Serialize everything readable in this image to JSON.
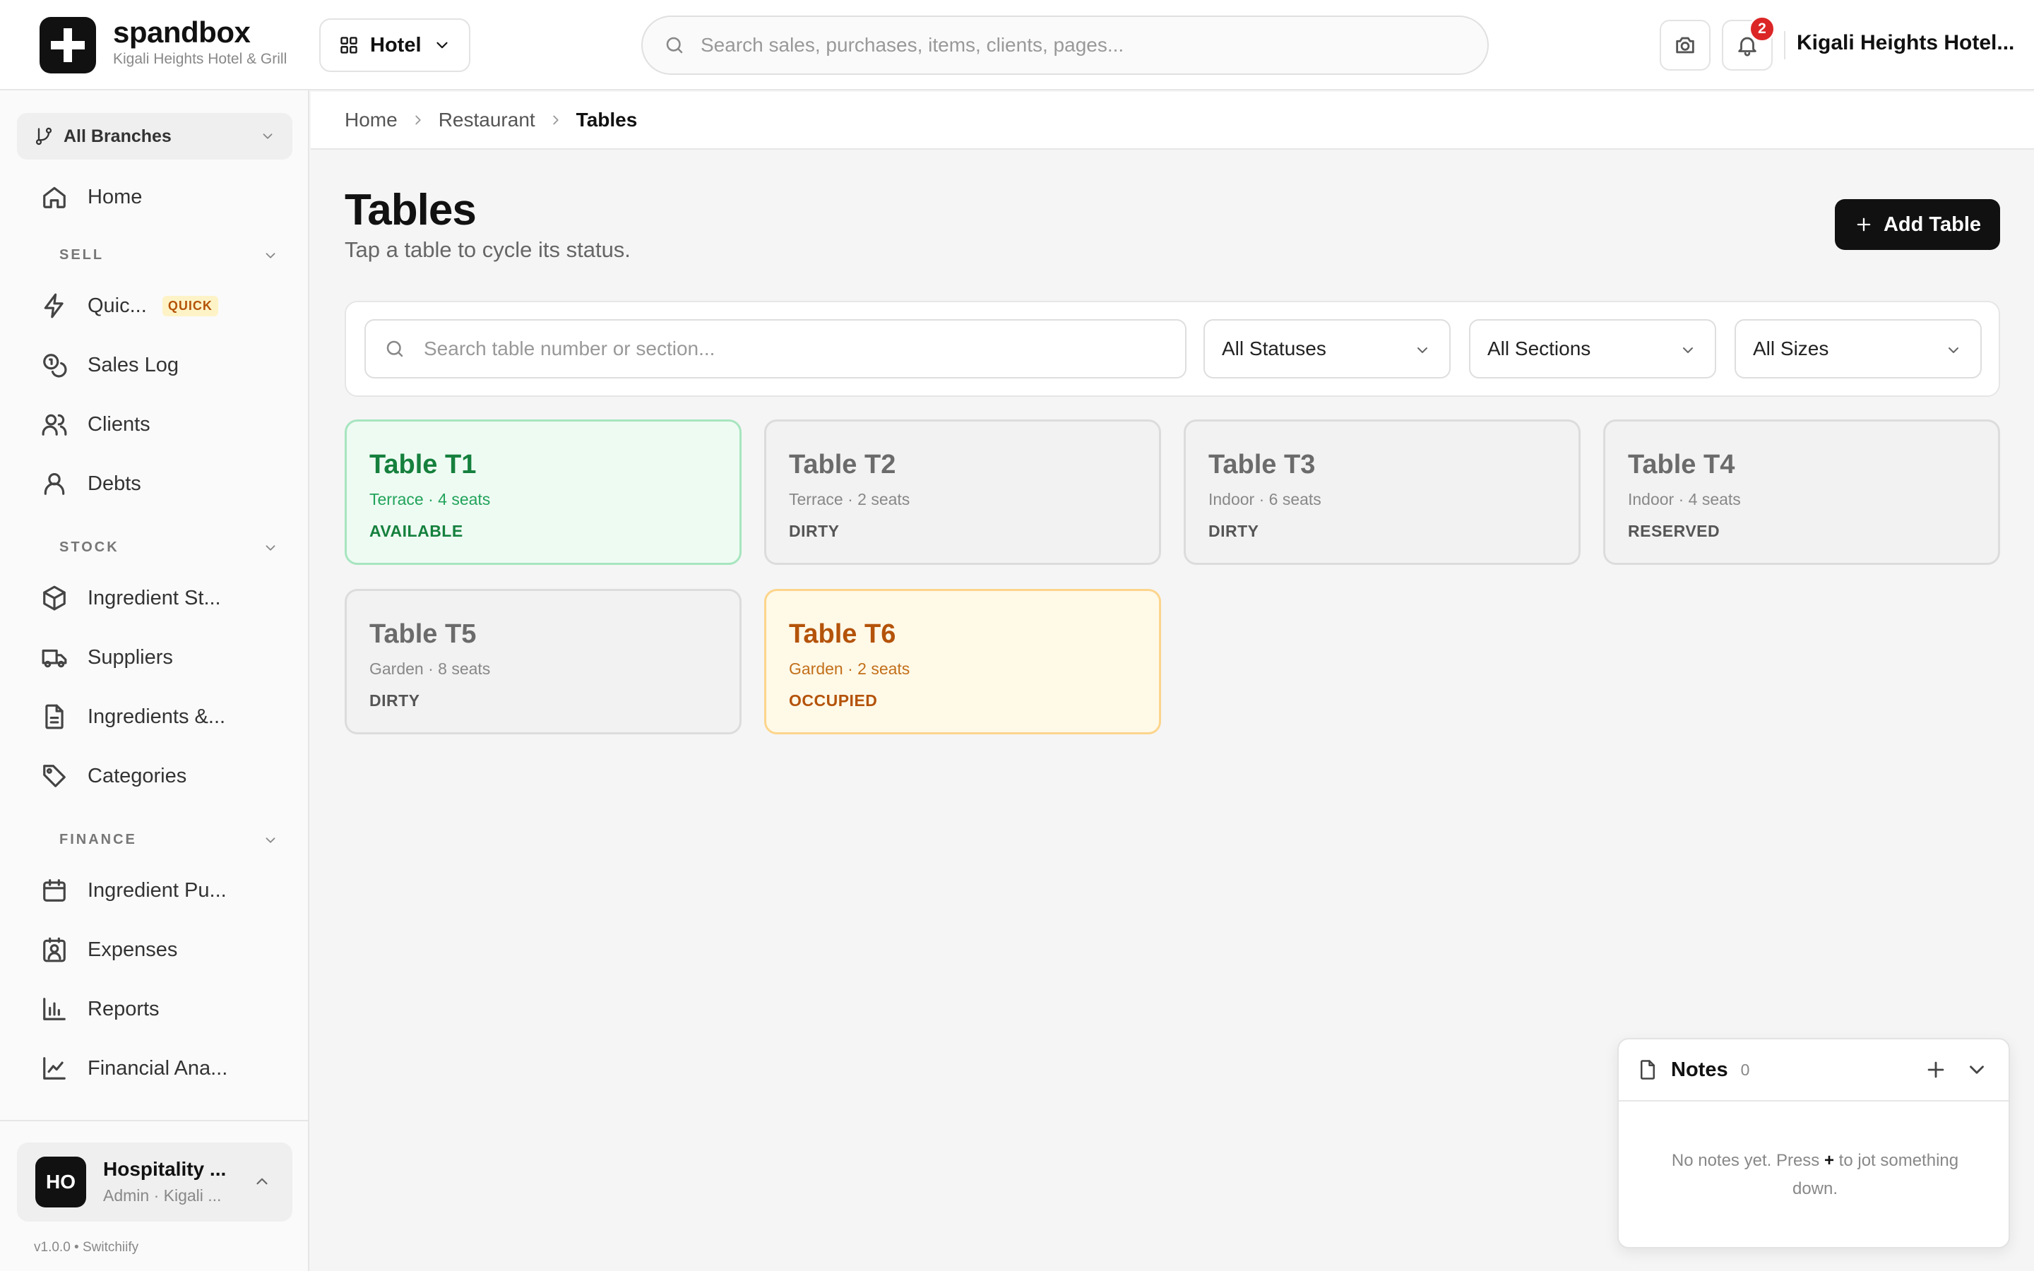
{
  "brand": {
    "name": "spandbox",
    "subtitle": "Kigali Heights Hotel & Grill"
  },
  "header": {
    "module_label": "Hotel",
    "search_placeholder": "Search sales, purchases, items, clients, pages...",
    "notification_count": "2",
    "account_name": "Kigali Heights Hotel..."
  },
  "sidebar": {
    "branch_label": "All Branches",
    "home": "Home",
    "sections": {
      "sell": "SELL",
      "stock": "STOCK",
      "finance": "FINANCE"
    },
    "sell_items": [
      {
        "label": "Quic...",
        "tag": "QUICK"
      },
      {
        "label": "Sales Log"
      },
      {
        "label": "Clients"
      },
      {
        "label": "Debts"
      }
    ],
    "stock_items": [
      {
        "label": "Ingredient St..."
      },
      {
        "label": "Suppliers"
      },
      {
        "label": "Ingredients &..."
      },
      {
        "label": "Categories"
      }
    ],
    "finance_items": [
      {
        "label": "Ingredient Pu..."
      },
      {
        "label": "Expenses"
      },
      {
        "label": "Reports"
      },
      {
        "label": "Financial Ana..."
      }
    ],
    "user": {
      "initials": "HO",
      "name": "Hospitality ...",
      "role": "Admin · Kigali ..."
    },
    "version": "v1.0.0 • Switchiify"
  },
  "breadcrumb": {
    "items": [
      "Home",
      "Restaurant"
    ],
    "current": "Tables"
  },
  "page": {
    "title": "Tables",
    "subtitle": "Tap a table to cycle its status.",
    "add_button": "Add Table"
  },
  "filters": {
    "search_placeholder": "Search table number or section...",
    "status": "All Statuses",
    "section": "All Sections",
    "size": "All Sizes"
  },
  "tables": [
    {
      "name": "Table T1",
      "meta": "Terrace · 4 seats",
      "status": "AVAILABLE"
    },
    {
      "name": "Table T2",
      "meta": "Terrace · 2 seats",
      "status": "DIRTY"
    },
    {
      "name": "Table T3",
      "meta": "Indoor · 6 seats",
      "status": "DIRTY"
    },
    {
      "name": "Table T4",
      "meta": "Indoor · 4 seats",
      "status": "RESERVED"
    },
    {
      "name": "Table T5",
      "meta": "Garden · 8 seats",
      "status": "DIRTY"
    },
    {
      "name": "Table T6",
      "meta": "Garden · 2 seats",
      "status": "OCCUPIED"
    }
  ],
  "notes": {
    "title": "Notes",
    "count": "0",
    "empty_before": "No notes yet. Press",
    "empty_key": "+",
    "empty_after": "to jot something down."
  },
  "colors": {
    "brand": "#111111",
    "available": "#15803d",
    "occupied": "#b45309",
    "badge": "#dc2626",
    "quick_tag": "#b45309"
  }
}
